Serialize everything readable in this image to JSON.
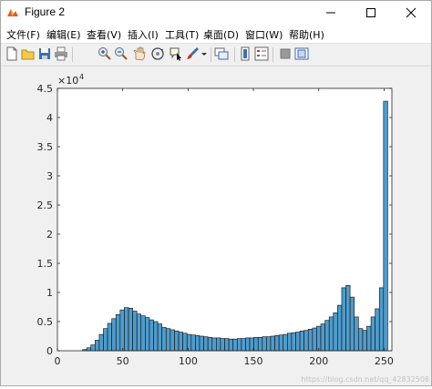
{
  "window": {
    "title": "Figure 2",
    "icons": {
      "app": "matlab-figure-icon",
      "minimize": "minimize-icon",
      "maximize": "maximize-icon",
      "close": "close-icon"
    }
  },
  "menu": {
    "items": [
      {
        "label": "文件(F)"
      },
      {
        "label": "编辑(E)"
      },
      {
        "label": "查看(V)"
      },
      {
        "label": "插入(I)"
      },
      {
        "label": "工具(T)"
      },
      {
        "label": "桌面(D)"
      },
      {
        "label": "窗口(W)"
      },
      {
        "label": "帮助(H)"
      }
    ]
  },
  "toolbar": {
    "buttons": [
      {
        "icon": "new-figure-icon"
      },
      {
        "icon": "open-file-icon"
      },
      {
        "icon": "save-icon"
      },
      {
        "icon": "print-icon"
      },
      {
        "icon": "zoom-in-icon"
      },
      {
        "icon": "zoom-out-icon"
      },
      {
        "icon": "pan-icon"
      },
      {
        "icon": "rotate-3d-icon"
      },
      {
        "icon": "data-cursor-icon"
      },
      {
        "icon": "brush-icon"
      },
      {
        "icon": "brush-dropdown-icon"
      },
      {
        "icon": "link-plot-icon"
      },
      {
        "icon": "colorbar-icon"
      },
      {
        "icon": "legend-icon"
      },
      {
        "icon": "hide-plot-tools-icon"
      },
      {
        "icon": "show-plot-tools-icon"
      }
    ]
  },
  "chart_data": {
    "type": "bar",
    "exponent_label": "×10",
    "exponent_power": "4",
    "bin_width": 3.2,
    "x_ticks": [
      0,
      50,
      100,
      150,
      200,
      250
    ],
    "xlim": [
      0,
      256
    ],
    "y_ticks": [
      0,
      0.5,
      1,
      1.5,
      2,
      2.5,
      3,
      3.5,
      4,
      4.5
    ],
    "ylim": [
      0,
      4.5
    ],
    "y_unit_multiplier": 10000,
    "bar_color": "#4f9ccb",
    "bin_starts": [
      0,
      3.2,
      6.4,
      9.6,
      12.8,
      16,
      19.2,
      22.4,
      25.6,
      28.8,
      32,
      35.2,
      38.4,
      41.6,
      44.8,
      48,
      51.2,
      54.4,
      57.6,
      60.8,
      64,
      67.2,
      70.4,
      73.6,
      76.8,
      80,
      83.2,
      86.4,
      89.6,
      92.8,
      96,
      99.2,
      102.4,
      105.6,
      108.8,
      112,
      115.2,
      118.4,
      121.6,
      124.8,
      128,
      131.2,
      134.4,
      137.6,
      140.8,
      144,
      147.2,
      150.4,
      153.6,
      156.8,
      160,
      163.2,
      166.4,
      169.6,
      172.8,
      176,
      179.2,
      182.4,
      185.6,
      188.8,
      192,
      195.2,
      198.4,
      201.6,
      204.8,
      208,
      211.2,
      214.4,
      217.6,
      220.8,
      224,
      227.2,
      230.4,
      233.6,
      236.8,
      240,
      243.2,
      246.4,
      249.6,
      252.8
    ],
    "values": [
      0,
      0,
      0,
      0,
      0,
      0,
      0.02,
      0.05,
      0.1,
      0.18,
      0.28,
      0.38,
      0.47,
      0.55,
      0.62,
      0.7,
      0.74,
      0.73,
      0.68,
      0.63,
      0.6,
      0.57,
      0.53,
      0.5,
      0.46,
      0.4,
      0.38,
      0.36,
      0.34,
      0.32,
      0.3,
      0.28,
      0.27,
      0.26,
      0.25,
      0.24,
      0.23,
      0.22,
      0.22,
      0.21,
      0.21,
      0.2,
      0.2,
      0.21,
      0.21,
      0.22,
      0.22,
      0.23,
      0.23,
      0.24,
      0.24,
      0.25,
      0.26,
      0.27,
      0.28,
      0.3,
      0.31,
      0.32,
      0.34,
      0.35,
      0.37,
      0.39,
      0.42,
      0.46,
      0.52,
      0.58,
      0.65,
      0.78,
      1.08,
      1.12,
      0.92,
      0.58,
      0.38,
      0.35,
      0.42,
      0.58,
      0.72,
      1.08,
      4.28
    ]
  },
  "watermark": "https://blog.csdn.net/qq_42832508"
}
